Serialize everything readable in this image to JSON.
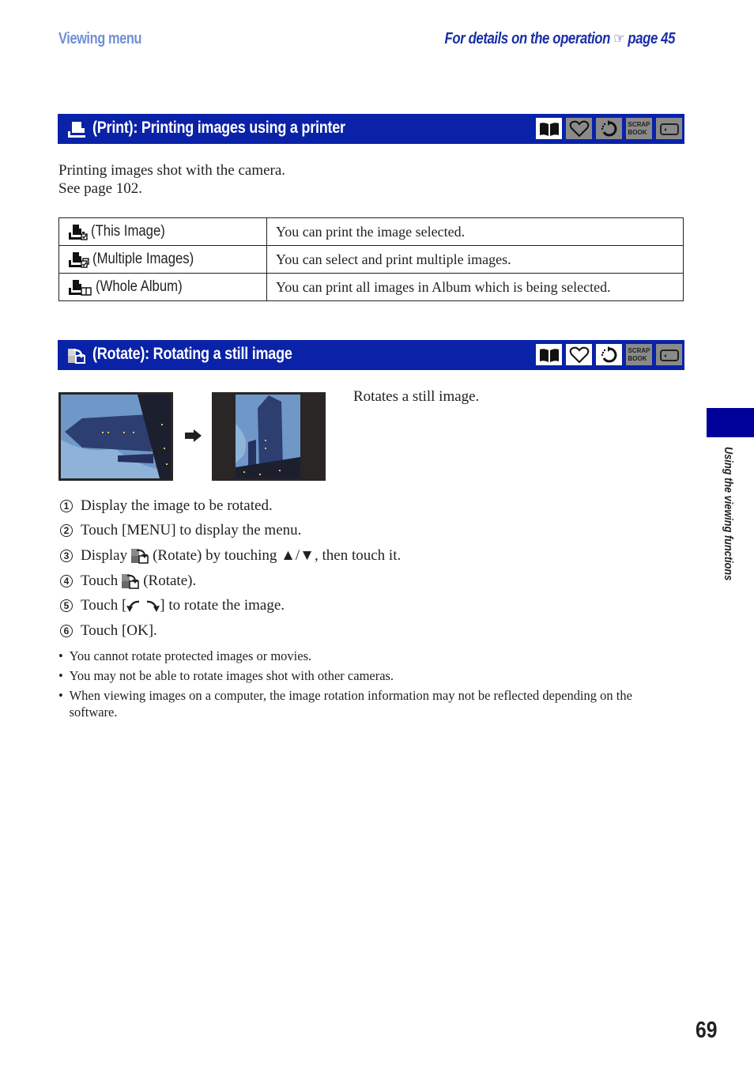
{
  "header": {
    "section": "Viewing menu",
    "details_prefix": "For details on the operation",
    "details_icon": "pointing-hand-icon",
    "details_page": "page 45"
  },
  "print_section": {
    "title": "(Print): Printing images using a printer",
    "title_icon": "print-icon",
    "mode_icons": [
      {
        "name": "album-mode-icon",
        "active": true
      },
      {
        "name": "favorites-mode-icon",
        "active": false
      },
      {
        "name": "history-mode-icon",
        "active": false
      },
      {
        "name": "scrapbook-mode-icon",
        "label": "SCRAP BOOK",
        "active": false
      },
      {
        "name": "internal-memory-mode-icon",
        "active": false
      }
    ],
    "intro_line1": "Printing images shot with the camera.",
    "intro_line2": "See page 102.",
    "options": [
      {
        "label": "(This Image)",
        "icon": "print-this-image-icon",
        "description": "You can print the image selected."
      },
      {
        "label": "(Multiple Images)",
        "icon": "print-multiple-images-icon",
        "description": "You can select and print multiple images."
      },
      {
        "label": "(Whole Album)",
        "icon": "print-whole-album-icon",
        "description": "You can print all images in Album which is being selected."
      }
    ]
  },
  "rotate_section": {
    "title": "(Rotate): Rotating a still image",
    "title_icon": "rotate-icon",
    "mode_icons": [
      {
        "name": "album-mode-icon",
        "active": true
      },
      {
        "name": "favorites-mode-icon",
        "active": true
      },
      {
        "name": "history-mode-icon",
        "active": true
      },
      {
        "name": "scrapbook-mode-icon",
        "label": "SCRAP BOOK",
        "active": false
      },
      {
        "name": "internal-memory-mode-icon",
        "active": false
      }
    ],
    "description": "Rotates a still image.",
    "steps": [
      {
        "num": "1",
        "text": "Display the image to be rotated."
      },
      {
        "num": "2",
        "text": "Touch [MENU] to display the menu."
      },
      {
        "num": "3",
        "pre": "Display",
        "post": "(Rotate) by touching ▲/▼, then touch it."
      },
      {
        "num": "4",
        "pre": "Touch",
        "post": "(Rotate)."
      },
      {
        "num": "5",
        "pre": "Touch [",
        "post": "] to rotate the image."
      },
      {
        "num": "6",
        "text": "Touch [OK]."
      }
    ],
    "notes": [
      "You cannot rotate protected images or movies.",
      "You may not be able to rotate images shot with other cameras.",
      "When viewing images on a computer, the image rotation information may not be reflected depending on the software."
    ]
  },
  "sidebar": {
    "chapter": "Using the viewing functions",
    "accent_color": "#00009a"
  },
  "page_number": "69",
  "colors": {
    "bar_blue": "#0a22a8",
    "header_light_blue": "#6f8fd8",
    "header_dark_blue": "#1a2fa8"
  }
}
